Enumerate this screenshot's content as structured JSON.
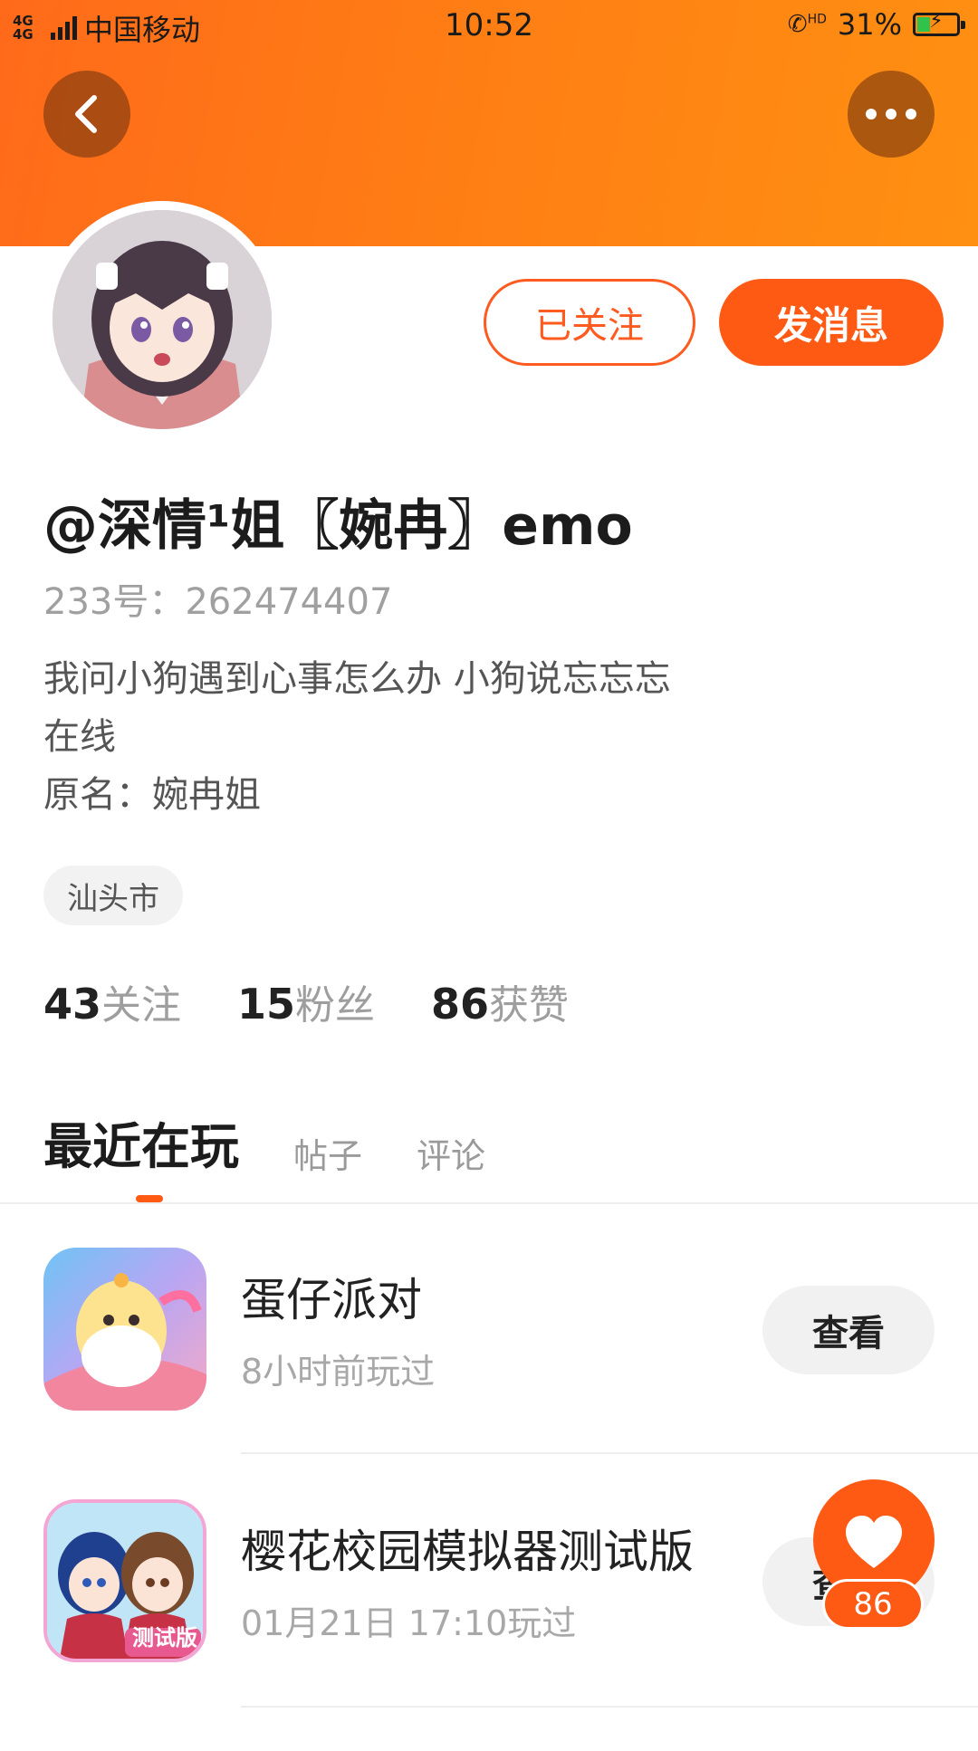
{
  "status_bar": {
    "network": "4G 4G",
    "carrier": "中国移动",
    "time": "10:52",
    "hd_call": "HD",
    "battery_percent": "31%",
    "battery_level": 0.31
  },
  "header": {
    "back_icon": "chevron-left-icon",
    "more_icon": "more-dots-icon",
    "gradient_start": "#ff6a1a",
    "gradient_end": "#ff9012"
  },
  "profile": {
    "avatar_icon": "anime-girl-avatar",
    "followed_label": "已关注",
    "message_label": "发消息",
    "username": "@深情¹姐〖婉冉〗emo",
    "id_text": "233号：262474407",
    "bio_lines": [
      "我问小狗遇到心事怎么办 小狗说忘忘忘",
      "在线",
      "原名：婉冉姐"
    ],
    "location": "汕头市"
  },
  "stats": [
    {
      "value": "43",
      "label": "关注"
    },
    {
      "value": "15",
      "label": "粉丝"
    },
    {
      "value": "86",
      "label": "获赞"
    }
  ],
  "tabs": [
    {
      "label": "最近在玩",
      "active": true
    },
    {
      "label": "帖子",
      "active": false
    },
    {
      "label": "评论",
      "active": false
    }
  ],
  "games": [
    {
      "title": "蛋仔派对",
      "time": "8小时前玩过",
      "button": "查看",
      "icon": "eggy-party-game-icon"
    },
    {
      "title": "樱花校园模拟器测试版",
      "time": "01月21日 17:10玩过",
      "button": "查看",
      "icon": "sakura-school-simulator-icon",
      "icon_badge": "测试版"
    }
  ],
  "like_fab": {
    "icon": "heart-icon",
    "count": "86"
  },
  "colors": {
    "accent": "#ff5a14",
    "muted_text": "#a0a0a0"
  }
}
